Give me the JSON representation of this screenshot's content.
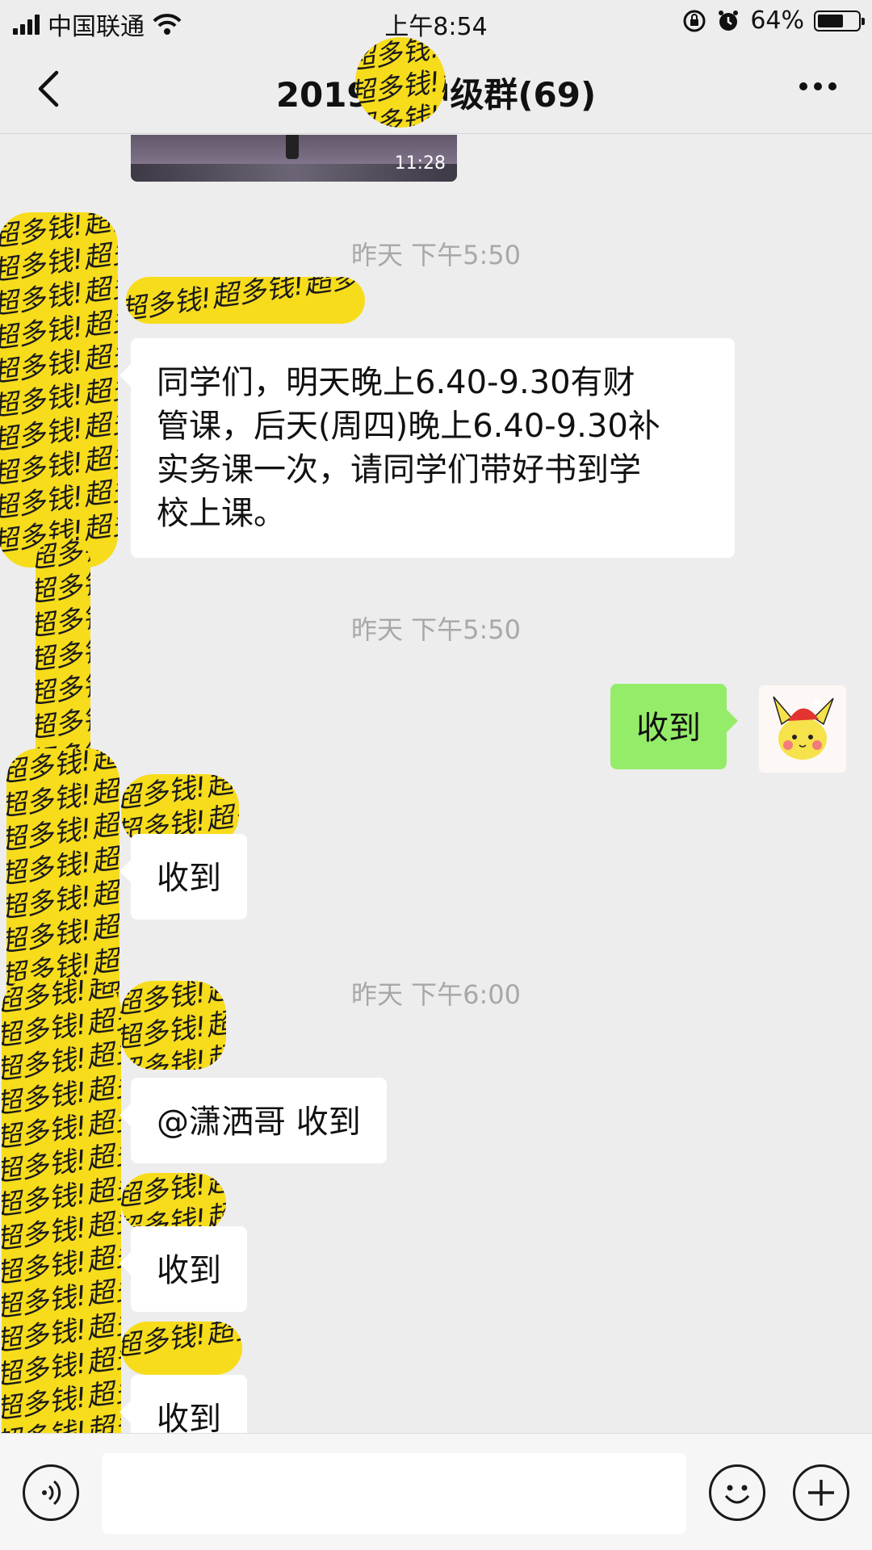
{
  "status_bar": {
    "carrier": "中国联通",
    "time": "上午8:54",
    "battery_percent": "64%",
    "battery_level": 0.64
  },
  "nav": {
    "title": "2019年   中级群(69)"
  },
  "video": {
    "duration": "11:28"
  },
  "messages": [
    {
      "timestamp": "昨天 下午5:50",
      "text": "同学们，明天晚上6.40-9.30有财管课，后天(周四)晚上6.40-9.30补实务课一次，请同学们带好书到学校上课。",
      "lines": [
        "同学们，明天晚上6.40-9.30有财",
        "管课，后天(周四)晚上6.40-9.30补",
        "实务课一次，请同学们带好书到学",
        "校上课。"
      ]
    },
    {
      "timestamp": "昨天 下午5:50",
      "text": "收到"
    },
    {
      "text": "收到"
    },
    {
      "timestamp": "昨天 下午6:00",
      "text": "@潇洒哥 收到"
    },
    {
      "text": "收到"
    },
    {
      "text": "收到"
    }
  ],
  "redaction_text": "超多钱!超多钱!超多钱!",
  "colors": {
    "background": "#ededed",
    "self_bubble": "#95ec69",
    "other_bubble": "#ffffff",
    "redaction": "#f7dc1c"
  },
  "icons": [
    "signal-icon",
    "wifi-icon",
    "rotation-lock-icon",
    "alarm-icon",
    "battery-icon",
    "back-icon",
    "more-icon",
    "voice-icon",
    "emoji-icon",
    "plus-icon"
  ]
}
